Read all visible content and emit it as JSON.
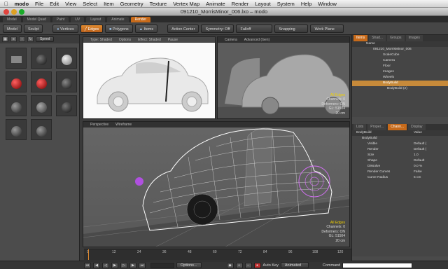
{
  "menubar": {
    "app": "modo",
    "items": [
      "File",
      "Edit",
      "View",
      "Select",
      "Item",
      "Geometry",
      "Texture",
      "Vertex Map",
      "Animate",
      "Render",
      "Layout",
      "System",
      "Help",
      "Window"
    ]
  },
  "window": {
    "title": "091210_MorrisMinor_006.lxo – modo"
  },
  "layout_tabs": [
    {
      "label": "Model",
      "active": false
    },
    {
      "label": "Model Quad",
      "active": false
    },
    {
      "label": "Paint",
      "active": false
    },
    {
      "label": "UV",
      "active": false
    },
    {
      "label": "Layout",
      "active": false
    },
    {
      "label": "Animate",
      "active": false
    },
    {
      "label": "Render",
      "active": true
    }
  ],
  "toolbar": {
    "model": "Model",
    "sculpt": "Sculpt",
    "vertices": "Vertices",
    "edges": "Edges",
    "polygons": "Polygons",
    "items": "Items",
    "action_center": "Action Center",
    "symmetry": "Symmetry: Off",
    "falloff": "Falloff",
    "snapping": "Snapping",
    "work_plane": "Work Plane"
  },
  "left_panel": {
    "speed": "Speed"
  },
  "viewports": {
    "top_left": {
      "tabs": [
        "Type: Shaded",
        "Options",
        "Effect: Shaded",
        "Pause"
      ]
    },
    "top_right": {
      "tabs": [
        "Camera",
        "Advanced (Gen)"
      ],
      "status": "All Edges",
      "channels": "Channels: 0",
      "deformers": "Deformers: ON",
      "gl": "GL: 51504",
      "size": "20 cm"
    },
    "bottom": {
      "tabs": [
        "Perspective",
        "Wireframe"
      ],
      "status": "All Edges",
      "channels": "Channels: 0",
      "deformers": "Deformers: ON",
      "gl": "GL: 51504",
      "size": "20 cm"
    }
  },
  "items_panel": {
    "tabs": [
      "Items",
      "Shad...",
      "Groups",
      "Images"
    ],
    "header": "Name",
    "rows": [
      "091210_MorrisMinor_006",
      "ScaleCube",
      "Camera",
      "Floor",
      "Images",
      "Wheels",
      "BodyBuild",
      "BodyBuild (2)"
    ]
  },
  "properties_panel": {
    "tabs": [
      "Lists",
      "Proper...",
      "Chann...",
      "Display"
    ],
    "header_name": "BodyBuild",
    "header_value": "Value",
    "item": "BodyBuild",
    "rows": [
      {
        "name": "Visible",
        "value": "Default ("
      },
      {
        "name": "Render",
        "value": "Default ("
      },
      {
        "name": "Size",
        "value": "1.0"
      },
      {
        "name": "Shape",
        "value": "Default"
      },
      {
        "name": "Dissolve",
        "value": "0.0 %"
      },
      {
        "name": "Render Curves",
        "value": "False"
      },
      {
        "name": "Curve Radius",
        "value": "5 cm"
      }
    ]
  },
  "timeline": {
    "ticks": [
      "0",
      "12",
      "24",
      "36",
      "48",
      "60",
      "72",
      "84",
      "96",
      "108",
      "120"
    ]
  },
  "bottom_bar": {
    "options": "Options...",
    "auto_key": "Auto Key",
    "animated": "Animated",
    "command": "Command"
  }
}
